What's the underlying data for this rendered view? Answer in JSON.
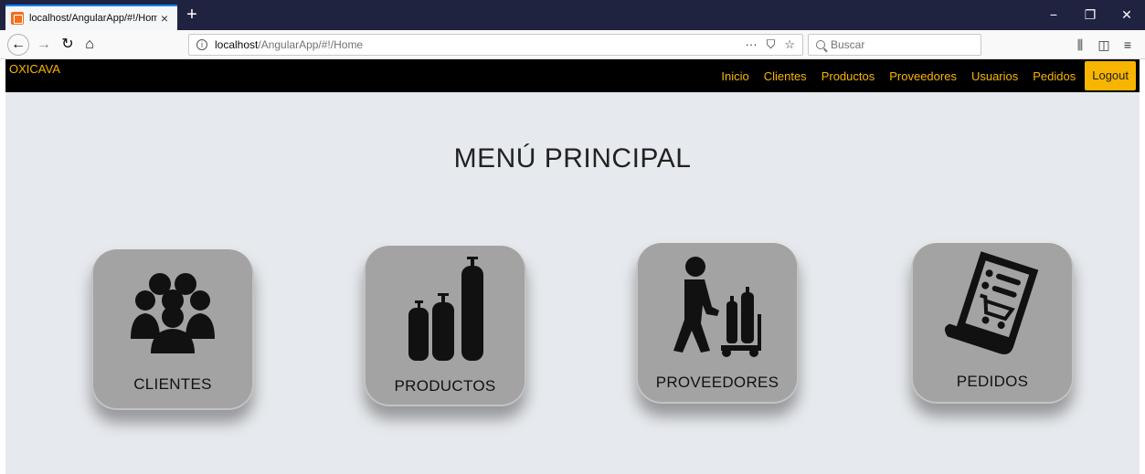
{
  "browser": {
    "tab_title": "localhost/AngularApp/#!/Home",
    "tab_close": "×",
    "new_tab": "+",
    "url_host": "localhost",
    "url_path": "/AngularApp/#!/Home",
    "url_actions": [
      "···",
      "⛉",
      "☆"
    ],
    "search_placeholder": "Buscar",
    "window_controls": [
      "−",
      "❐",
      "✕"
    ]
  },
  "header": {
    "brand": "OXICAVA",
    "menu": [
      "Inicio",
      "Clientes",
      "Productos",
      "Proveedores",
      "Usuarios",
      "Pedidos"
    ],
    "logout": "Logout"
  },
  "main": {
    "title": "MENÚ PRINCIPAL",
    "cards": [
      {
        "label": "CLIENTES",
        "icon": "people-group-icon"
      },
      {
        "label": "PRODUCTOS",
        "icon": "gas-cylinders-icon"
      },
      {
        "label": "PROVEEDORES",
        "icon": "worker-cart-icon"
      },
      {
        "label": "PEDIDOS",
        "icon": "order-list-icon"
      }
    ]
  },
  "colors": {
    "accent": "#f7b500",
    "header_bg": "#000000",
    "page_bg": "#e6e9ed",
    "card_bg": "#a3a3a3"
  }
}
